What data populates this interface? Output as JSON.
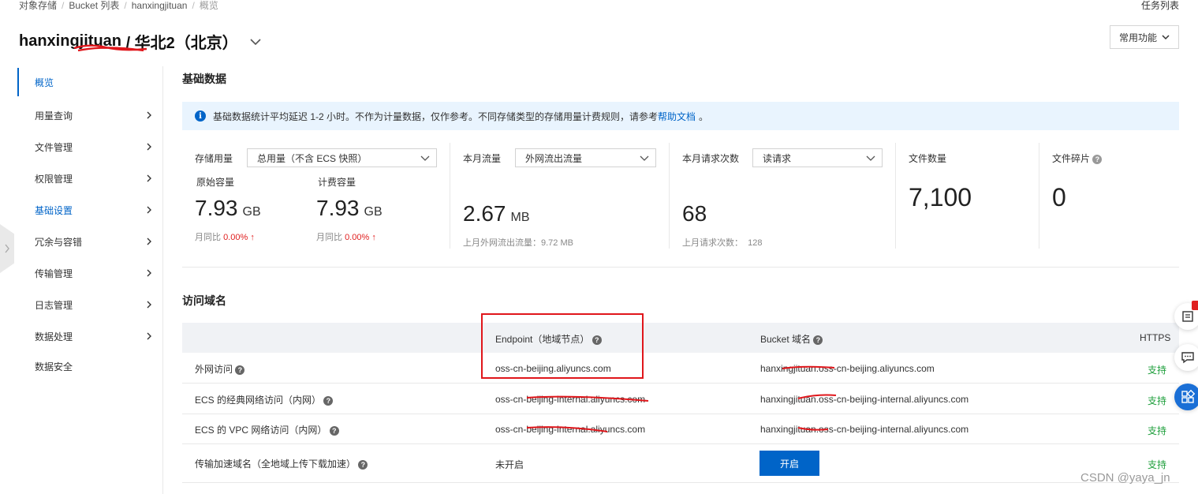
{
  "breadcrumb": [
    "对象存储",
    "Bucket 列表",
    "hanxingjituan",
    "概览"
  ],
  "header": {
    "task_list": "任务列表",
    "bucket_name": "hanxingjituan",
    "region": "/ 华北2（北京）",
    "common_functions": "常用功能"
  },
  "sidebar": {
    "items": [
      {
        "label": "概览"
      },
      {
        "label": "用量查询"
      },
      {
        "label": "文件管理"
      },
      {
        "label": "权限管理"
      },
      {
        "label": "基础设置"
      },
      {
        "label": "冗余与容错"
      },
      {
        "label": "传输管理"
      },
      {
        "label": "日志管理"
      },
      {
        "label": "数据处理"
      },
      {
        "label": "数据安全"
      }
    ]
  },
  "basic": {
    "title": "基础数据",
    "banner_text": "基础数据统计平均延迟 1-2 小时。不作为计量数据，仅作参考。不同存储类型的存储用量计费规则，请参考",
    "banner_link": "帮助文档",
    "banner_end": "。",
    "storage": {
      "label": "存储用量",
      "select": "总用量（不含 ECS 快照）",
      "raw_label": "原始容量",
      "raw_value": "7.93",
      "raw_unit": "GB",
      "bill_label": "计费容量",
      "bill_value": "7.93",
      "bill_unit": "GB",
      "yoy_label": "月同比",
      "yoy_value": "0.00%"
    },
    "traffic": {
      "label": "本月流量",
      "select": "外网流出流量",
      "value": "2.67",
      "unit": "MB",
      "last_month": "上月外网流出流量：9.72 MB"
    },
    "requests": {
      "label": "本月请求次数",
      "select": "读请求",
      "value": "68",
      "last_month_label": "上月请求次数：",
      "last_month_value": "128"
    },
    "files": {
      "label": "文件数量",
      "value": "7,100"
    },
    "fragments": {
      "label": "文件碎片",
      "value": "0"
    }
  },
  "domains": {
    "title": "访问域名",
    "headers": {
      "endpoint": "Endpoint（地域节点）",
      "bucket": "Bucket 域名",
      "https": "HTTPS"
    },
    "rows": [
      {
        "name": "外网访问",
        "endpoint": "oss-cn-beijing.aliyuncs.com",
        "bucket": "hanxingjituan.oss-cn-beijing.aliyuncs.com",
        "https": "支持"
      },
      {
        "name": "ECS 的经典网络访问（内网）",
        "endpoint": "oss-cn-beijing-internal.aliyuncs.com",
        "bucket": "hanxingjituan.oss-cn-beijing-internal.aliyuncs.com",
        "https": "支持"
      },
      {
        "name": "ECS 的 VPC 网络访问（内网）",
        "endpoint": "oss-cn-beijing-internal.aliyuncs.com",
        "bucket": "hanxingjituan.oss-cn-beijing-internal.aliyuncs.com",
        "https": "支持"
      },
      {
        "name": "传输加速域名（全地域上传下载加速）",
        "endpoint": "未开启",
        "bucket_button": "开启",
        "https": "支持"
      }
    ]
  },
  "watermark": "CSDN @yaya_jn",
  "colors": {
    "accent": "#0064c8",
    "success": "#1f9f3c",
    "danger": "#e02020",
    "banner_bg": "#e9f4fe"
  }
}
